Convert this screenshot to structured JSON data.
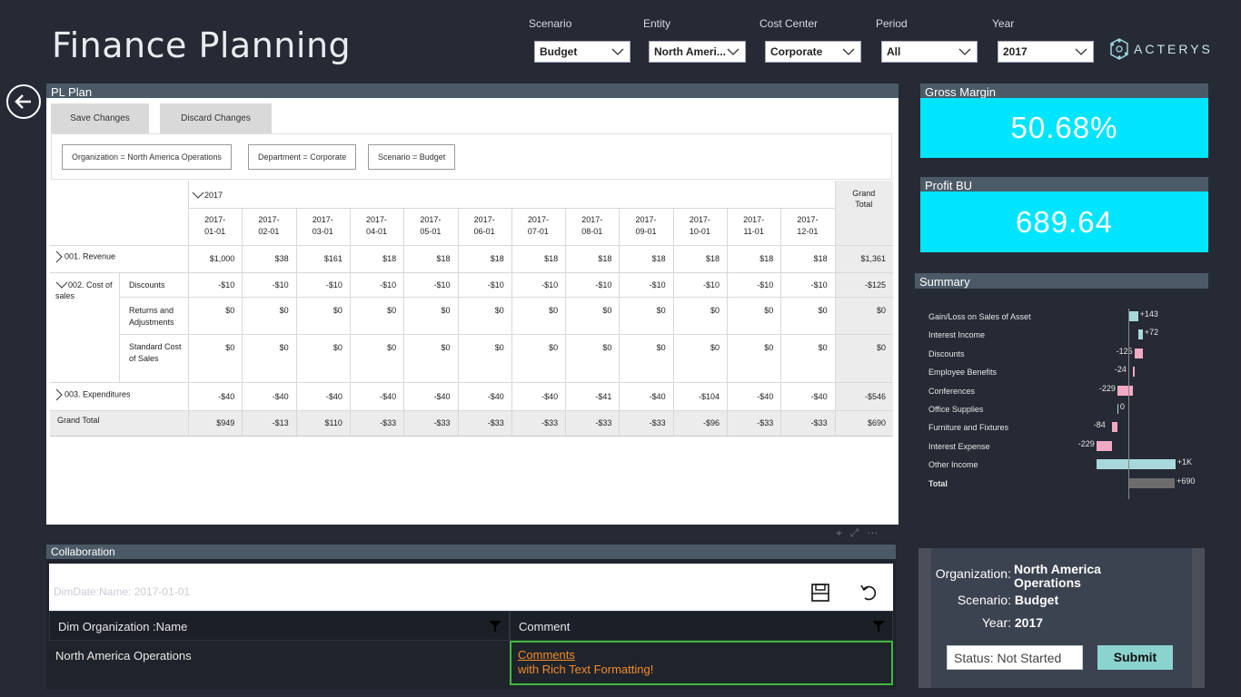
{
  "app": {
    "title": "Finance Planning",
    "logo_text": "ACTERYS"
  },
  "filters": [
    {
      "label": "Scenario",
      "value": "Budget"
    },
    {
      "label": "Entity",
      "value": "North Ameri..."
    },
    {
      "label": "Cost Center",
      "value": "Corporate"
    },
    {
      "label": "Period",
      "value": "All"
    },
    {
      "label": "Year",
      "value": "2017"
    }
  ],
  "pl_plan": {
    "title": "PL Plan",
    "save_label": "Save Changes",
    "discard_label": "Discard Changes",
    "pills": [
      "Organization = North America Operations",
      "Department = Corporate",
      "Scenario = Budget"
    ],
    "year_label": "2017",
    "grand_total_header": "Grand Total",
    "months": [
      "2017-01-01",
      "2017-02-01",
      "2017-03-01",
      "2017-04-01",
      "2017-05-01",
      "2017-06-01",
      "2017-07-01",
      "2017-08-01",
      "2017-09-01",
      "2017-10-01",
      "2017-11-01",
      "2017-12-01"
    ],
    "rows": [
      {
        "label": "001. Revenue",
        "sub": "",
        "values": [
          "$1,000",
          "$38",
          "$161",
          "$18",
          "$18",
          "$18",
          "$18",
          "$18",
          "$18",
          "$18",
          "$18",
          "$18"
        ],
        "total": "$1,361"
      },
      {
        "label": "002. Cost of sales",
        "sub": "Discounts",
        "values": [
          "-$10",
          "-$10",
          "-$10",
          "-$10",
          "-$10",
          "-$10",
          "-$10",
          "-$10",
          "-$10",
          "-$10",
          "-$10",
          "-$10"
        ],
        "total": "-$125"
      },
      {
        "label": "",
        "sub": "Returns and Adjustments",
        "values": [
          "$0",
          "$0",
          "$0",
          "$0",
          "$0",
          "$0",
          "$0",
          "$0",
          "$0",
          "$0",
          "$0",
          "$0"
        ],
        "total": "$0"
      },
      {
        "label": "",
        "sub": "Standard Cost of Sales",
        "values": [
          "$0",
          "$0",
          "$0",
          "$0",
          "$0",
          "$0",
          "$0",
          "$0",
          "$0",
          "$0",
          "$0",
          "$0"
        ],
        "total": "$0"
      },
      {
        "label": "003. Expenditures",
        "sub": "",
        "values": [
          "-$40",
          "-$40",
          "-$40",
          "-$40",
          "-$40",
          "-$40",
          "-$40",
          "-$41",
          "-$40",
          "-$104",
          "-$40",
          "-$40"
        ],
        "total": "-$546"
      },
      {
        "label": "Grand Total",
        "sub": "",
        "values": [
          "$949",
          "-$13",
          "$110",
          "-$33",
          "-$33",
          "-$33",
          "-$33",
          "-$33",
          "-$33",
          "-$96",
          "-$33",
          "-$33"
        ],
        "total": "$690"
      }
    ]
  },
  "collaboration": {
    "title": "Collaboration",
    "dimdate": "DimDate:Name: 2017-01-01",
    "col1_header": "Dim Organization :Name",
    "col2_header": "Comment",
    "row_org": "North America Operations",
    "comment_link": "Comments",
    "comment_text": "with Rich Text Formatting!"
  },
  "kpis": {
    "gross_margin_title": "Gross Margin",
    "gross_margin_value": "50.68%",
    "profit_title": "Profit BU",
    "profit_value": "689.64"
  },
  "summary": {
    "title": "Summary",
    "items": [
      {
        "label": "Gain/Loss on Sales of Asset",
        "value_label": "+143",
        "value": 143
      },
      {
        "label": "Interest Income",
        "value_label": "+72",
        "value": 72
      },
      {
        "label": "Discounts",
        "value_label": "-125",
        "value": -125
      },
      {
        "label": "Employee Benefits",
        "value_label": "-24",
        "value": -24
      },
      {
        "label": "Conferences",
        "value_label": "-229",
        "value": -229
      },
      {
        "label": "Office Supplies",
        "value_label": "0",
        "value": 0
      },
      {
        "label": "Furniture and Fixtures",
        "value_label": "-84",
        "value": -84
      },
      {
        "label": "Interest Expense",
        "value_label": "-229",
        "value": -229
      },
      {
        "label": "Other Income",
        "value_label": "+1K",
        "value": 1175
      },
      {
        "label": "Total",
        "value_label": "+690",
        "value": 690
      }
    ],
    "colors": {
      "increase": "#a8d8dc",
      "decrease": "#f2a9c3",
      "total": "#6d6d6d"
    }
  },
  "status": {
    "org_label": "Organization:",
    "org_value": "North America Operations",
    "scenario_label": "Scenario:",
    "scenario_value": "Budget",
    "year_label": "Year:",
    "year_value": "2017",
    "status_text": "Status: Not Started",
    "submit_label": "Submit"
  }
}
